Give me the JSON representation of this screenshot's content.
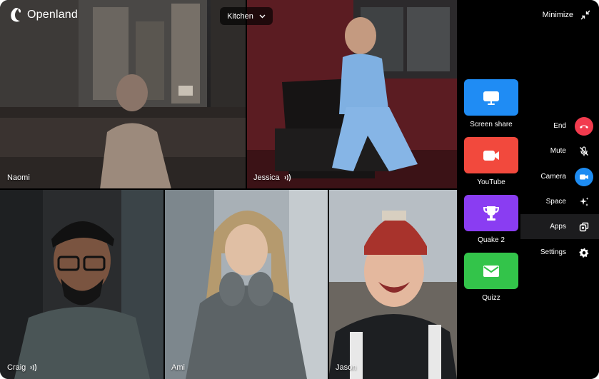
{
  "app": {
    "brand": "Openland"
  },
  "room": {
    "name": "Kitchen"
  },
  "participants": [
    {
      "name": "Naomi",
      "speaking": false
    },
    {
      "name": "Jessica",
      "speaking": true
    },
    {
      "name": "Craig",
      "speaking": true
    },
    {
      "name": "Ami",
      "speaking": false
    },
    {
      "name": "Jason",
      "speaking": false
    }
  ],
  "panel": {
    "minimize_label": "Minimize",
    "apps": [
      {
        "label": "Screen share",
        "icon": "monitor-icon",
        "color": "#1f8cf4"
      },
      {
        "label": "YouTube",
        "icon": "video-camera-icon",
        "color": "#f2493d"
      },
      {
        "label": "Quake 2",
        "icon": "trophy-icon",
        "color": "#8a3df2"
      },
      {
        "label": "Quizz",
        "icon": "mail-icon",
        "color": "#33c44a"
      }
    ],
    "controls": [
      {
        "label": "End",
        "icon": "phone-hangup-icon",
        "color": "#f23b4e"
      },
      {
        "label": "Mute",
        "icon": "mic-off-icon"
      },
      {
        "label": "Camera",
        "icon": "camera-icon",
        "color": "#1e8cf2"
      },
      {
        "label": "Space",
        "icon": "sparkles-icon"
      },
      {
        "label": "Apps",
        "icon": "apps-icon",
        "active": true
      },
      {
        "label": "Settings",
        "icon": "gear-icon"
      }
    ]
  }
}
